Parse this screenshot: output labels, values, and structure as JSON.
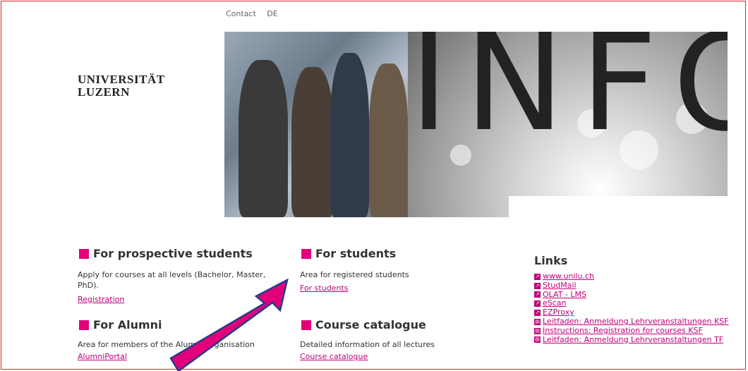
{
  "topnav": {
    "contact": "Contact",
    "language": "DE"
  },
  "logo": {
    "line1": "UNIVERSITÄT",
    "line2": "LUZERN"
  },
  "hero": {
    "word": "INFO"
  },
  "prospective": {
    "title": "For prospective students",
    "text": "Apply for courses at all levels (Bachelor, Master, PhD).",
    "link": "Registration"
  },
  "alumni": {
    "title": "For Alumni",
    "text": "Area for members of the Alumni Organisation",
    "link": "AlumniPortal"
  },
  "students": {
    "title": "For students",
    "text": "Area for registered students",
    "link": "For students"
  },
  "catalogue": {
    "title": "Course catalogue",
    "text": "Detailed information of all lectures",
    "link": "Course catalogue"
  },
  "links": {
    "title": "Links",
    "items": [
      {
        "label": "www.unilu.ch",
        "icon": "external-link-icon"
      },
      {
        "label": "StudMail",
        "icon": "external-link-icon"
      },
      {
        "label": "OLAT - LMS",
        "icon": "external-link-icon"
      },
      {
        "label": "eScan",
        "icon": "external-link-icon"
      },
      {
        "label": "EZProxy",
        "icon": "external-link-icon"
      },
      {
        "label": "Leitfaden: Anmeldung Lehrveranstaltungen KSF",
        "icon": "pdf-icon"
      },
      {
        "label": "Instructions: Registration for courses KSF",
        "icon": "pdf-icon"
      },
      {
        "label": "Leitfaden: Anmeldung Lehrveranstaltungen TF",
        "icon": "pdf-icon"
      }
    ]
  },
  "colors": {
    "accent": "#e2007a",
    "frame": "#d9262c",
    "link": "#c0007a"
  }
}
